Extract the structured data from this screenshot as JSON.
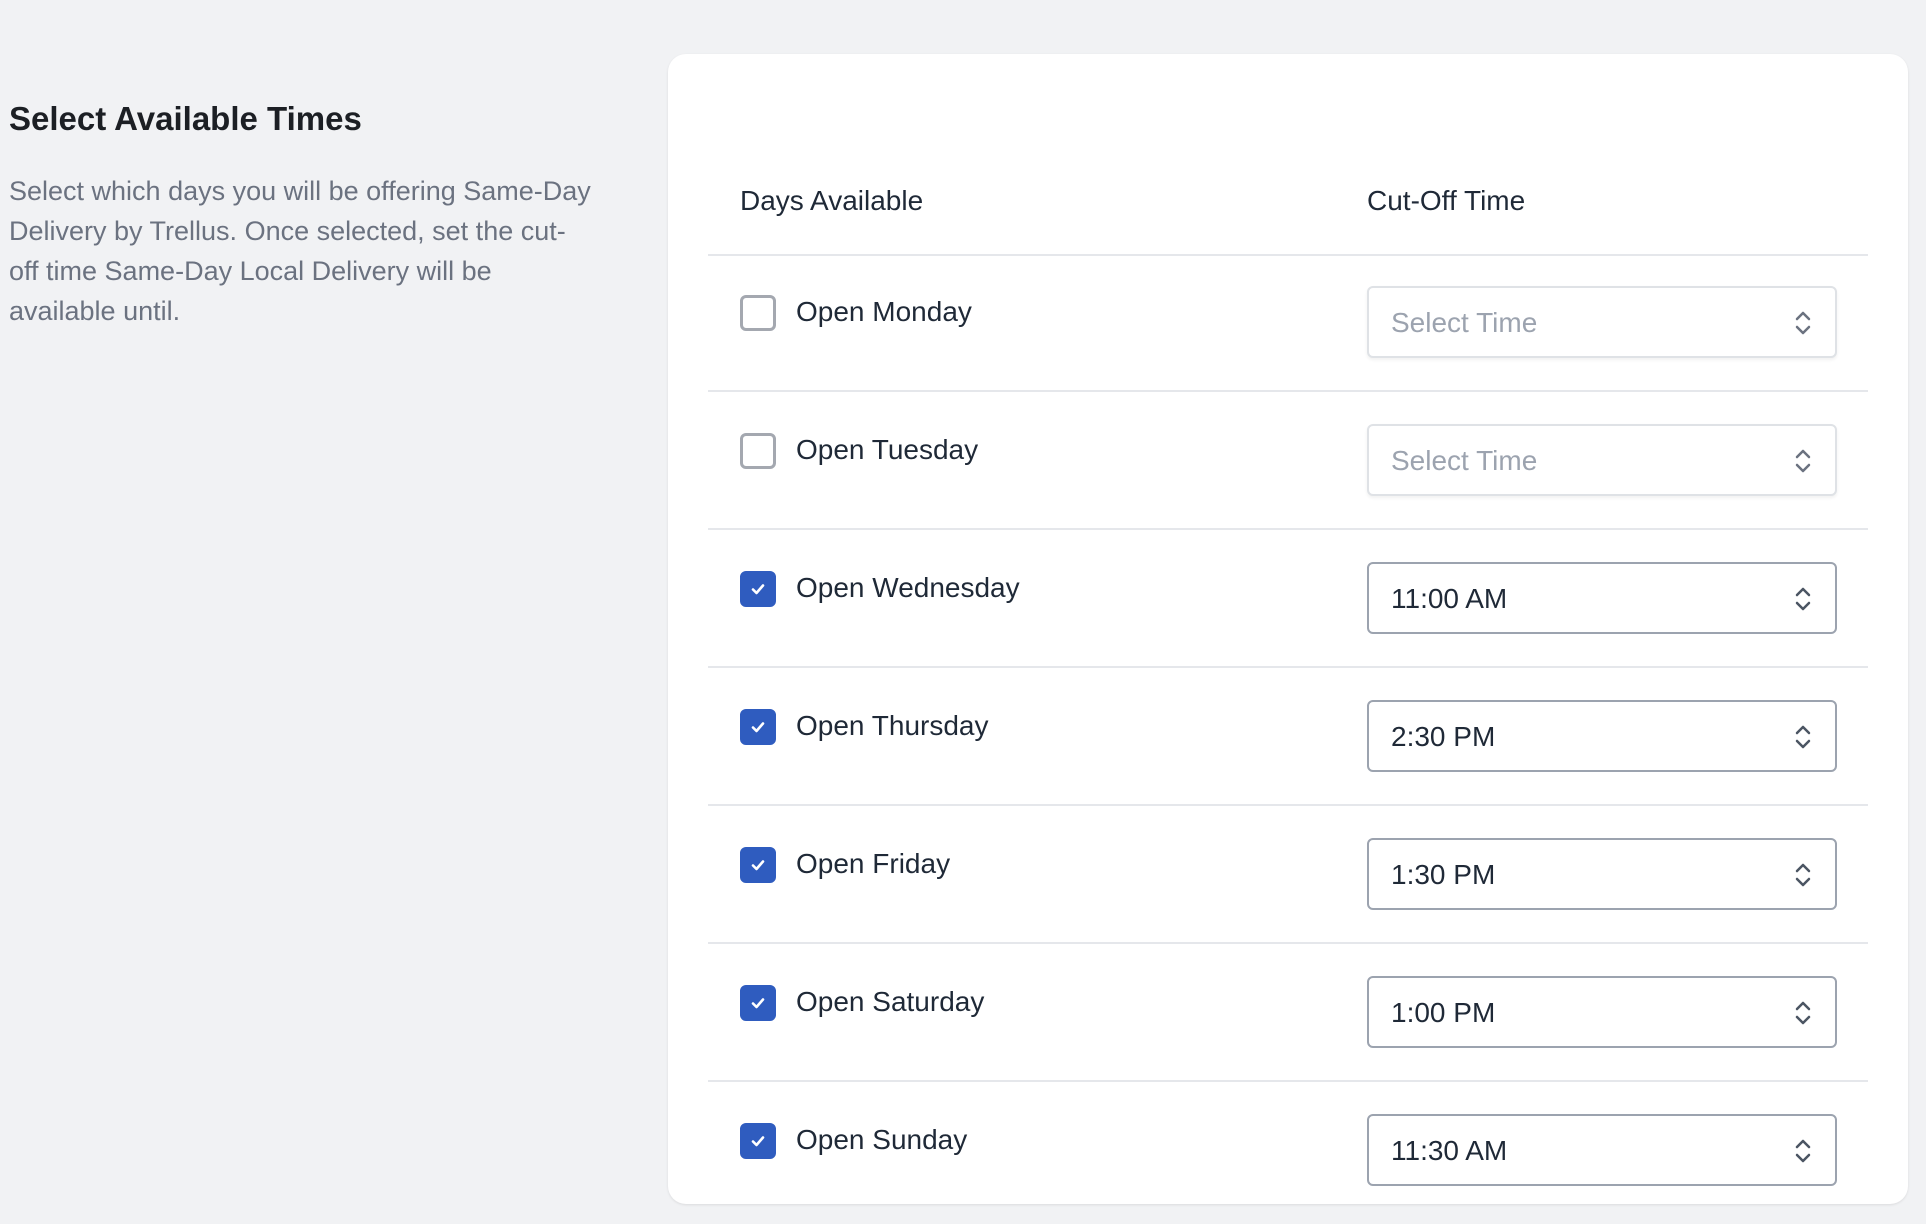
{
  "intro": {
    "title": "Select Available Times",
    "description": "Select which days you will be offering Same-Day Delivery by Trellus. Once selected, set the cut-off time Same-Day Local Delivery will be available until."
  },
  "table": {
    "col_days": "Days Available",
    "col_cutoff": "Cut-Off Time",
    "placeholder": "Select Time",
    "rows": [
      {
        "label": "Open Monday",
        "checked": false,
        "time": "Select Time"
      },
      {
        "label": "Open Tuesday",
        "checked": false,
        "time": "Select Time"
      },
      {
        "label": "Open Wednesday",
        "checked": true,
        "time": "11:00 AM"
      },
      {
        "label": "Open Thursday",
        "checked": true,
        "time": "2:30 PM"
      },
      {
        "label": "Open Friday",
        "checked": true,
        "time": "1:30 PM"
      },
      {
        "label": "Open Saturday",
        "checked": true,
        "time": "1:00 PM"
      },
      {
        "label": "Open Sunday",
        "checked": true,
        "time": "11:30 AM"
      }
    ]
  },
  "colors": {
    "accent": "#2f5cbf",
    "background": "#f1f2f4",
    "card": "#ffffff"
  },
  "icons": {
    "checkbox_mark": "check-icon",
    "select_arrows": "chevron-up-down-icon"
  }
}
